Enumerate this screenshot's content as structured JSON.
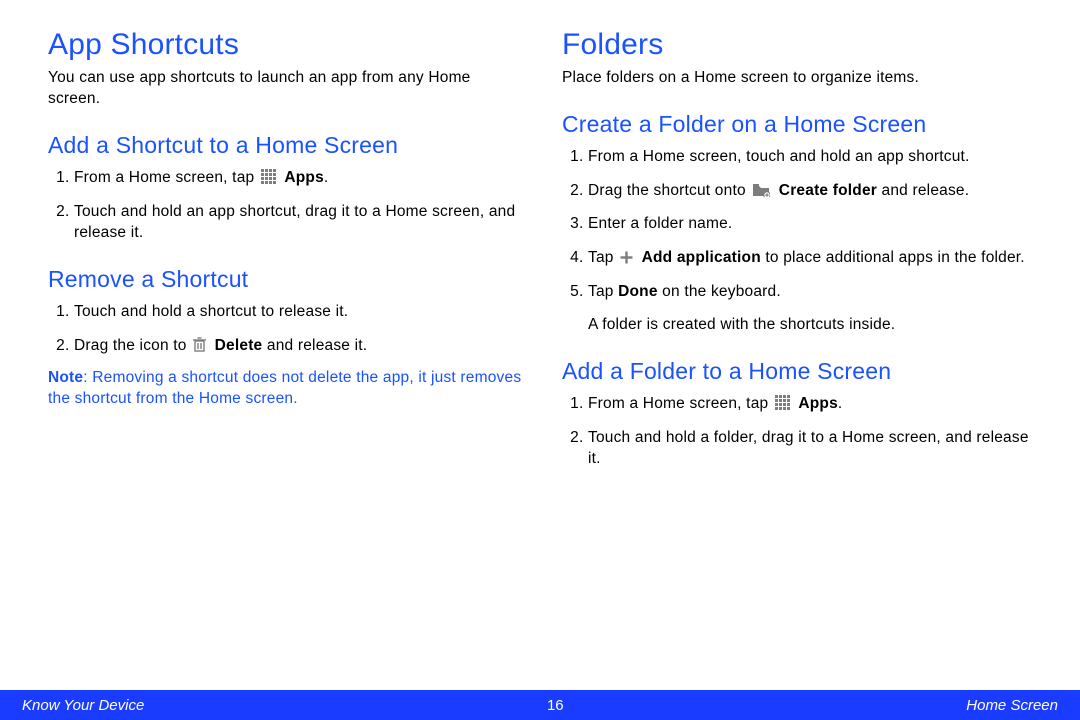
{
  "left": {
    "h1": "App Shortcuts",
    "intro": "You can use app shortcuts to launch an app from any Home screen.",
    "sec1": {
      "title": "Add a Shortcut to a Home Screen",
      "items": {
        "s1a": "From a Home screen, tap ",
        "s1b": "Apps",
        "s1c": ".",
        "s2": "Touch and hold an app shortcut, drag it to a Home screen, and release it."
      }
    },
    "sec2": {
      "title": "Remove a Shortcut",
      "items": {
        "s1": "Touch and hold a shortcut to release it.",
        "s2a": "Drag the icon to ",
        "s2b": "Delete",
        "s2c": " and release it."
      }
    },
    "note_label": "Note",
    "note_text": ": Removing a shortcut does not delete the app, it just removes the shortcut from the Home screen."
  },
  "right": {
    "h1": "Folders",
    "intro": "Place folders on a Home screen to organize items.",
    "sec1": {
      "title": "Create a Folder on a Home Screen",
      "items": {
        "s1": "From a Home screen, touch and hold an app shortcut.",
        "s2a": "Drag the shortcut onto ",
        "s2b": "Create folder",
        "s2c": " and release.",
        "s3": "Enter a folder name.",
        "s4a": "Tap ",
        "s4b": "Add application",
        "s4c": " to place additional apps in the folder.",
        "s5a": "Tap ",
        "s5b": "Done",
        "s5c": " on the keyboard.",
        "tail": "A folder is created with the shortcuts inside."
      }
    },
    "sec2": {
      "title": "Add a Folder to a Home Screen",
      "items": {
        "s1a": "From a Home screen, tap ",
        "s1b": "Apps",
        "s1c": ".",
        "s2": "Touch and hold a folder, drag it to a Home screen, and release it."
      }
    }
  },
  "footer": {
    "left": "Know Your Device",
    "center": "16",
    "right": "Home Screen"
  },
  "icons": {
    "apps": "apps-grid-icon",
    "trash": "trash-icon",
    "folder_add": "folder-add-icon",
    "plus": "plus-icon"
  },
  "colors": {
    "brand_blue": "#1a52ff",
    "footer_blue": "#1a3cff",
    "gray_icon": "#7d7d7d"
  }
}
